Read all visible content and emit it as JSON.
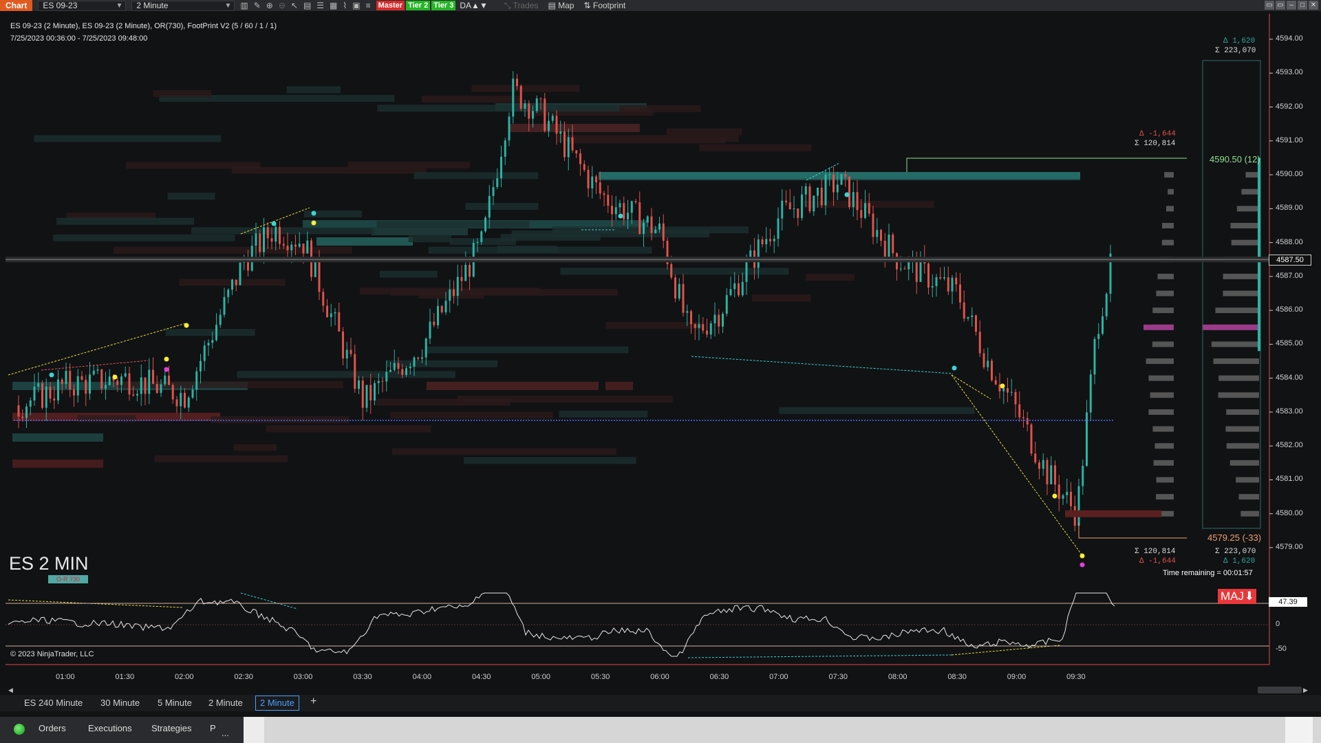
{
  "toolbar": {
    "chart_tab": "Chart",
    "instrument": "ES 09-23",
    "interval": "2 Minute",
    "badge_master": "Master",
    "badge_tier2": "Tier 2",
    "badge_tier3": "Tier 3",
    "da_label": "DA▲▼",
    "trades_label": "Trades",
    "map_label": "Map",
    "footprint_label": "Footprint",
    "icons": [
      "bar-type-icon",
      "draw-icon",
      "zoom-in-icon",
      "zoom-out-icon",
      "cursor-icon",
      "data-box-icon",
      "properties-icon",
      "indicators-icon",
      "strategies-icon",
      "templates-icon"
    ]
  },
  "chart": {
    "header_line1": "ES 09-23 (2 Minute), ES 09-23 (2 Minute), OR(730), FootPrint V2 (5 / 60 / 1 / 1)",
    "header_line2": "7/25/2023 00:36:00 - 7/25/2023 09:48:00",
    "watermark": "ES 2 MIN",
    "or_badge": "O-R 730",
    "copyright": "© 2023 NinjaTrader, LLC",
    "time_remaining": "Time remaining = 00:01:57",
    "last_price": "4587.50",
    "high_label": "4590.50 (12)",
    "low_label": "4579.25 (-33)",
    "top_delta": "Δ 1,620",
    "top_sigma": "Σ 223,070",
    "mid_delta": "Δ -1,644",
    "mid_sigma": "Σ 120,814",
    "bot_sigma_left": "Σ 120,814",
    "bot_delta_left": "Δ -1,644",
    "bot_sigma_right": "Σ 223,070",
    "bot_delta_right": "Δ 1,620",
    "maj_label": "MAJ",
    "osc_value": "47.39",
    "osc_ticks": [
      "0",
      "-50"
    ],
    "price_ticks": [
      "4594.00",
      "4593.00",
      "4592.00",
      "4591.00",
      "4590.00",
      "4589.00",
      "4588.00",
      "4587.00",
      "4586.00",
      "4585.00",
      "4584.00",
      "4583.00",
      "4582.00",
      "4581.00",
      "4580.00",
      "4579.00"
    ],
    "time_ticks": [
      "01:00",
      "01:30",
      "02:00",
      "02:30",
      "03:00",
      "03:30",
      "04:00",
      "04:30",
      "05:00",
      "05:30",
      "06:00",
      "06:30",
      "07:00",
      "07:30",
      "08:00",
      "08:30",
      "09:00",
      "09:30"
    ],
    "colors": {
      "up": "#2bb3a3",
      "down": "#e0524a",
      "bg": "#111214",
      "accent": "#e15b1f"
    }
  },
  "chart_data": {
    "type": "line",
    "ylim": [
      4578.5,
      4594.5
    ],
    "x": [
      "00:36",
      "01:00",
      "01:30",
      "02:00",
      "02:30",
      "02:45",
      "03:00",
      "03:30",
      "04:00",
      "04:30",
      "04:45",
      "05:00",
      "05:30",
      "06:00",
      "06:15",
      "06:30",
      "07:00",
      "07:30",
      "08:00",
      "08:30",
      "08:45",
      "09:00",
      "09:15",
      "09:30",
      "09:40",
      "09:48"
    ],
    "values": [
      4583.2,
      4583.8,
      4584.0,
      4583.5,
      4587.5,
      4588.4,
      4588.0,
      4583.3,
      4585.0,
      4588.0,
      4592.5,
      4591.8,
      4589.4,
      4588.3,
      4585.2,
      4586.0,
      4588.8,
      4589.8,
      4587.5,
      4586.5,
      4584.5,
      4583.0,
      4581.2,
      4580.0,
      4585.5,
      4587.5
    ]
  },
  "tabs": [
    "ES 240 Minute",
    "30 Minute",
    "5 Minute",
    "2 Minute",
    "2 Minute"
  ],
  "status": {
    "orders": "Orders",
    "executions": "Executions",
    "strategies": "Strategies",
    "more": "P",
    "ellipsis": "..."
  }
}
